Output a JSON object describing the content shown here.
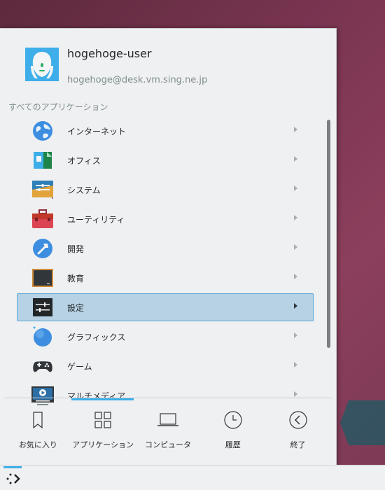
{
  "user": {
    "name": "hogehoge-user",
    "email": "hogehoge@desk.vm.sing.ne.jp"
  },
  "section_title": "すべてのアプリケーション",
  "apps": [
    {
      "label": "インターネット",
      "icon": "globe-icon"
    },
    {
      "label": "オフィス",
      "icon": "office-icon"
    },
    {
      "label": "システム",
      "icon": "system-icon"
    },
    {
      "label": "ユーティリティ",
      "icon": "toolbox-icon"
    },
    {
      "label": "開発",
      "icon": "hammer-icon"
    },
    {
      "label": "教育",
      "icon": "blackboard-icon"
    },
    {
      "label": "設定",
      "icon": "settings-sliders-icon",
      "selected": true
    },
    {
      "label": "グラフィックス",
      "icon": "graphics-sphere-icon"
    },
    {
      "label": "ゲーム",
      "icon": "gamepad-icon"
    },
    {
      "label": "マルチメディア",
      "icon": "multimedia-icon"
    }
  ],
  "tabs": [
    {
      "label": "お気に入り",
      "icon": "bookmark-icon"
    },
    {
      "label": "アプリケーション",
      "icon": "grid-icon",
      "active": true
    },
    {
      "label": "コンピュータ",
      "icon": "laptop-icon"
    },
    {
      "label": "履歴",
      "icon": "clock-icon"
    },
    {
      "label": "終了",
      "icon": "back-arrow-icon"
    }
  ],
  "colors": {
    "accent": "#3daee9",
    "selected_bg": "#b6d2e4",
    "menu_bg": "#eff0f1"
  }
}
